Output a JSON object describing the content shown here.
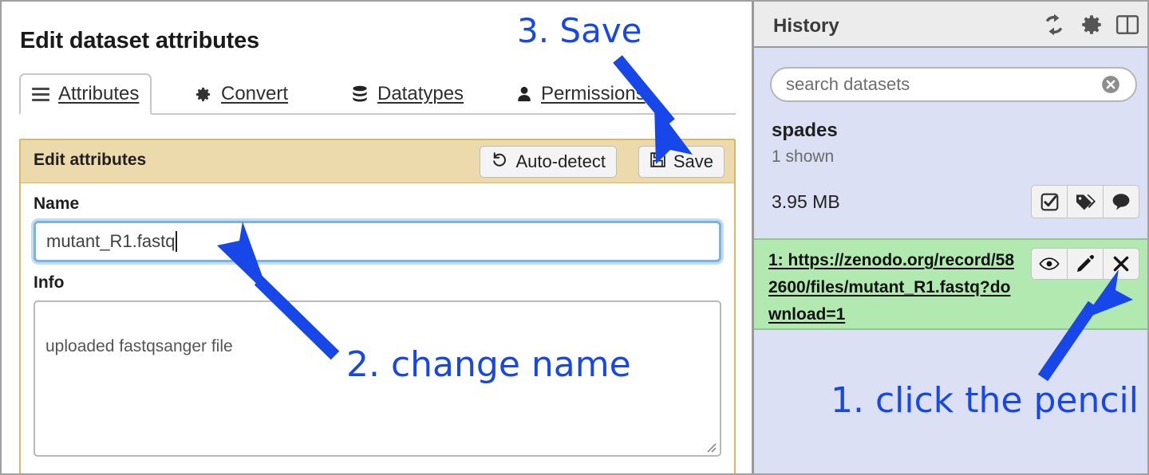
{
  "main": {
    "page_title": "Edit dataset attributes",
    "tabs": [
      {
        "label": "Attributes",
        "icon": "hamburger-icon",
        "active": true
      },
      {
        "label": "Convert",
        "icon": "gear-icon",
        "active": false
      },
      {
        "label": "Datatypes",
        "icon": "database-icon",
        "active": false
      },
      {
        "label": "Permissions",
        "icon": "user-icon",
        "active": false
      }
    ],
    "card": {
      "title": "Edit attributes",
      "autodetect_label": "Auto-detect",
      "autodetect_icon": "undo-arrow-icon",
      "save_label": "Save",
      "save_icon": "floppy-disk-icon",
      "header_bg": "#ecd9ac",
      "border_color": "#d9b86a"
    },
    "fields": {
      "name_label": "Name",
      "name_value": "mutant_R1.fastq",
      "info_label": "Info",
      "info_value": "uploaded fastqsanger file"
    }
  },
  "history": {
    "title": "History",
    "header_icons": [
      {
        "name": "refresh-icon"
      },
      {
        "name": "gear-icon"
      },
      {
        "name": "panels-icon"
      }
    ],
    "search": {
      "placeholder": "search datasets",
      "value": "",
      "clear_icon": "clear-circle-icon"
    },
    "history_name": "spades",
    "shown_count": "1 shown",
    "size": "3.95 MB",
    "meta_buttons": [
      {
        "name": "select-datasets-icon"
      },
      {
        "name": "tags-icon"
      },
      {
        "name": "annotation-icon"
      }
    ],
    "dataset": {
      "title": "1: https://zenodo.org/record/582600/files/mutant_R1.fastq?download=1",
      "state_color": "#b2e9b0",
      "actions": [
        {
          "name": "eye-icon"
        },
        {
          "name": "pencil-icon"
        },
        {
          "name": "delete-x-icon"
        }
      ]
    },
    "panel_bg": "#dce0f5"
  },
  "annotations": {
    "color": "#1747e8",
    "step1": "1. click the pencil",
    "step2": "2. change name",
    "step3": "3. Save"
  }
}
